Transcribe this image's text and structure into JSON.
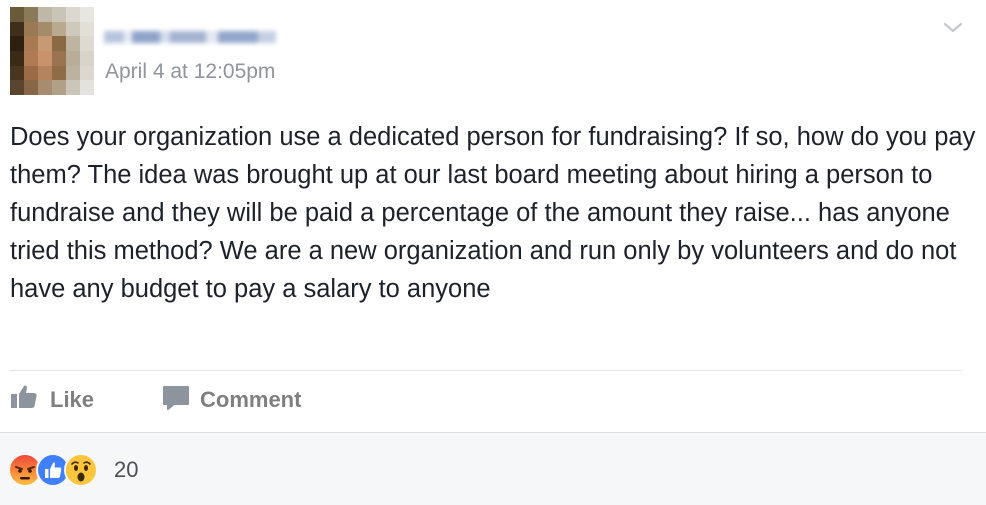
{
  "post": {
    "author_name": "",
    "timestamp": "April 4 at 12:05pm",
    "text": "Does your organization use a dedicated person for fundraising? If so, how do you pay them? The idea was brought up at our last board meeting about hiring a person to fundraise and they will be paid a percentage of the amount they raise... has anyone tried this method? We are a new organization and run only by volunteers and do not have any budget to pay a salary to anyone"
  },
  "actions": {
    "like_label": "Like",
    "comment_label": "Comment"
  },
  "reactions": {
    "icons": [
      "angry-reaction-icon",
      "like-reaction-icon",
      "wow-reaction-icon"
    ],
    "count": "20"
  },
  "colors": {
    "text": "#1d2129",
    "meta": "#90949c",
    "action": "#7f7f7f",
    "footer_bg": "#f6f7f9",
    "like_blue": "#4080ff",
    "angry_orange": "#f25d24",
    "wow_yellow": "#fcc53b"
  }
}
